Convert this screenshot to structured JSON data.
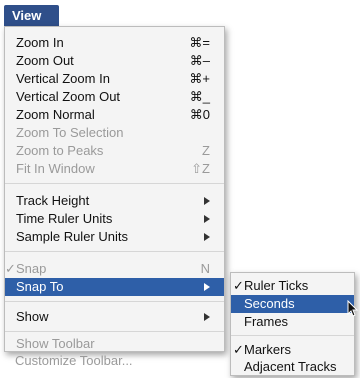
{
  "menubar": {
    "title": "View"
  },
  "menu": {
    "items": [
      {
        "label": "Zoom In",
        "shortcut": "⌘=",
        "enabled": true
      },
      {
        "label": "Zoom Out",
        "shortcut": "⌘–",
        "enabled": true
      },
      {
        "label": "Vertical Zoom In",
        "shortcut": "⌘+",
        "enabled": true
      },
      {
        "label": "Vertical Zoom Out",
        "shortcut": "⌘_",
        "enabled": true
      },
      {
        "label": "Zoom Normal",
        "shortcut": "⌘0",
        "enabled": true
      },
      {
        "label": "Zoom To Selection",
        "shortcut": "",
        "enabled": false
      },
      {
        "label": "Zoom to Peaks",
        "shortcut": "Z",
        "enabled": false
      },
      {
        "label": "Fit In Window",
        "shortcut": "⇧Z",
        "enabled": false
      },
      {
        "label": "Track Height",
        "submenu": true,
        "enabled": true
      },
      {
        "label": "Time Ruler Units",
        "submenu": true,
        "enabled": true
      },
      {
        "label": "Sample Ruler Units",
        "submenu": true,
        "enabled": true
      },
      {
        "label": "Snap",
        "shortcut": "N",
        "checked": true,
        "enabled": false
      },
      {
        "label": "Snap To",
        "submenu": true,
        "enabled": true,
        "highlighted": true
      },
      {
        "label": "Show",
        "submenu": true,
        "enabled": true
      },
      {
        "label": "Show Toolbar",
        "enabled": false
      },
      {
        "label": "Customize Toolbar...",
        "enabled": false
      }
    ]
  },
  "submenu": {
    "items": [
      {
        "label": "Ruler Ticks",
        "checked": true
      },
      {
        "label": "Seconds",
        "highlighted": true
      },
      {
        "label": "Frames"
      },
      {
        "label": "Markers",
        "checked": true
      },
      {
        "label": "Adjacent Tracks"
      }
    ]
  },
  "icons": {
    "check": "✓",
    "arrow": "submenu-arrow-icon",
    "cursor": "arrow-cursor-icon"
  },
  "colors": {
    "highlight": "#2e5fa8",
    "menubar_title_bg": "#2f4f8a",
    "disabled": "#9a9a9a"
  }
}
